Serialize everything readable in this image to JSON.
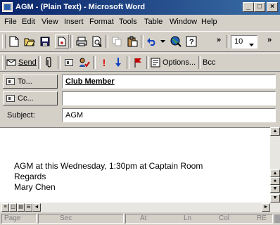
{
  "window": {
    "title": "AGM - (Plain Text) - Microsoft Word",
    "buttons": {
      "minimize": "_",
      "maximize": "□",
      "close": "×"
    }
  },
  "menu": [
    "File",
    "Edit",
    "View",
    "Insert",
    "Format",
    "Tools",
    "Table",
    "Window",
    "Help"
  ],
  "toolbar": {
    "font_size": "10",
    "overflow": "»"
  },
  "mail_toolbar": {
    "send_label": "Send",
    "options_label": "Options...",
    "bcc_label": "Bcc"
  },
  "header": {
    "to_label": "To...",
    "to_value": "Club Member",
    "cc_label": "Cc...",
    "cc_value": "",
    "subject_label": "Subject:",
    "subject_value": "AGM"
  },
  "body": {
    "lines": [
      "AGM at this Wednesday, 1:30pm at Captain Room",
      "Regards",
      "Mary Chen"
    ]
  },
  "status": {
    "page": "Page",
    "sec": "Sec",
    "at": "At",
    "ln": "Ln",
    "col": "Col",
    "rec": "RE"
  },
  "colors": {
    "titlebar": "#0a246a",
    "chrome": "#d4d0c8",
    "important": "#e00000",
    "low": "#1040c0",
    "flag": "#c00000"
  }
}
